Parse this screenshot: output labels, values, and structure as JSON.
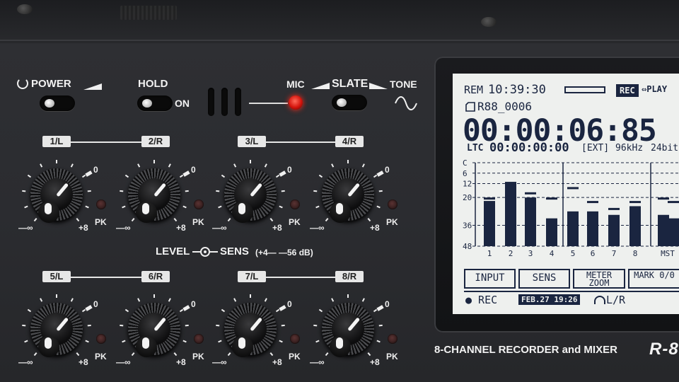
{
  "panel": {
    "power": "POWER",
    "hold": "HOLD",
    "hold_on": "ON",
    "mic": "MIC",
    "slate": "SLATE",
    "tone": "TONE",
    "level_sens": "LEVEL",
    "sens": "SENS",
    "sens_range": "(+4—  —56 dB)",
    "model_text": "8-CHANNEL RECORDER and MIXER",
    "logo": "R-8"
  },
  "channels": [
    {
      "label": "1/L"
    },
    {
      "label": "2/R"
    },
    {
      "label": "3/L"
    },
    {
      "label": "4/R"
    },
    {
      "label": "5/L"
    },
    {
      "label": "6/R"
    },
    {
      "label": "7/L"
    },
    {
      "label": "8/R"
    }
  ],
  "knob_marks": {
    "min": "—∞",
    "max": "+8",
    "zero": "0",
    "peak": "PK"
  },
  "lcd": {
    "rem_label": "REM",
    "rem_time": "10:39:30",
    "rec_badge": "REC",
    "play_text": "⇔PLAY",
    "filename": "R88_0006",
    "timecode": "00:00:06:85",
    "ltc_label": "LTC",
    "ltc_value": "00:00:00:00",
    "ltc_source": "[EXT]",
    "sample_rate": "96kHz",
    "bit_depth": "24bit",
    "scale_labels": [
      "C",
      "6",
      "12",
      "20",
      "36",
      "48"
    ],
    "channel_labels": [
      "1",
      "2",
      "3",
      "4",
      "5",
      "6",
      "7",
      "8",
      "MST"
    ],
    "softkeys": [
      "INPUT",
      "SENS",
      "METER ZOOM",
      "MARK 0/0"
    ],
    "status_rec": "● REC",
    "status_date": "FEB.27  19:26",
    "status_monitor": "L/R"
  },
  "meter_levels_db": {
    "note": "",
    "bars": [
      -22,
      -12,
      -20,
      -32,
      -28,
      -28,
      -30,
      -25,
      -30,
      -32
    ],
    "peaks": [
      -20,
      -11,
      -17,
      -20,
      -14,
      -22,
      -26,
      -22,
      -20,
      -22
    ]
  },
  "colors": {
    "lcd_bg": "#eef0ee",
    "lcd_ink": "#1a2540",
    "panel": "#2b2c30",
    "led_red": "#d4140c"
  }
}
